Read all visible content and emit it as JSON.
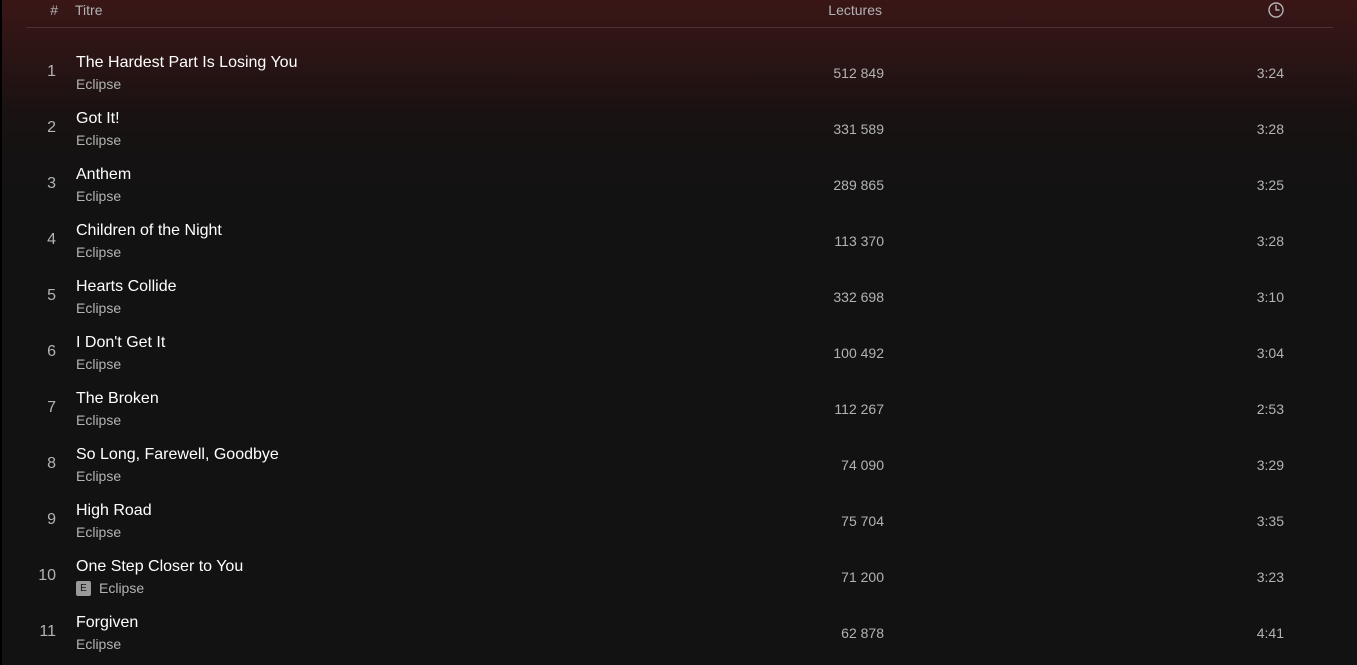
{
  "header": {
    "number_label": "#",
    "title_label": "Titre",
    "plays_label": "Lectures",
    "duration_icon": "clock-icon"
  },
  "tracks": [
    {
      "number": "1",
      "title": "The Hardest Part Is Losing You",
      "artist": "Eclipse",
      "plays": "512 849",
      "duration": "3:24",
      "explicit": false
    },
    {
      "number": "2",
      "title": "Got It!",
      "artist": "Eclipse",
      "plays": "331 589",
      "duration": "3:28",
      "explicit": false
    },
    {
      "number": "3",
      "title": "Anthem",
      "artist": "Eclipse",
      "plays": "289 865",
      "duration": "3:25",
      "explicit": false
    },
    {
      "number": "4",
      "title": "Children of the Night",
      "artist": "Eclipse",
      "plays": "113 370",
      "duration": "3:28",
      "explicit": false
    },
    {
      "number": "5",
      "title": "Hearts Collide",
      "artist": "Eclipse",
      "plays": "332 698",
      "duration": "3:10",
      "explicit": false
    },
    {
      "number": "6",
      "title": "I Don't Get It",
      "artist": "Eclipse",
      "plays": "100 492",
      "duration": "3:04",
      "explicit": false
    },
    {
      "number": "7",
      "title": "The Broken",
      "artist": "Eclipse",
      "plays": "112 267",
      "duration": "2:53",
      "explicit": false
    },
    {
      "number": "8",
      "title": "So Long, Farewell, Goodbye",
      "artist": "Eclipse",
      "plays": "74 090",
      "duration": "3:29",
      "explicit": false
    },
    {
      "number": "9",
      "title": "High Road",
      "artist": "Eclipse",
      "plays": "75 704",
      "duration": "3:35",
      "explicit": false
    },
    {
      "number": "10",
      "title": "One Step Closer to You",
      "artist": "Eclipse",
      "plays": "71 200",
      "duration": "3:23",
      "explicit": true,
      "explicit_label": "E"
    },
    {
      "number": "11",
      "title": "Forgiven",
      "artist": "Eclipse",
      "plays": "62 878",
      "duration": "4:41",
      "explicit": false
    }
  ],
  "colors": {
    "background": "#121212",
    "header_gradient_top": "#3a1616",
    "primary_text": "#ffffff",
    "secondary_text": "#b3b3b3"
  }
}
